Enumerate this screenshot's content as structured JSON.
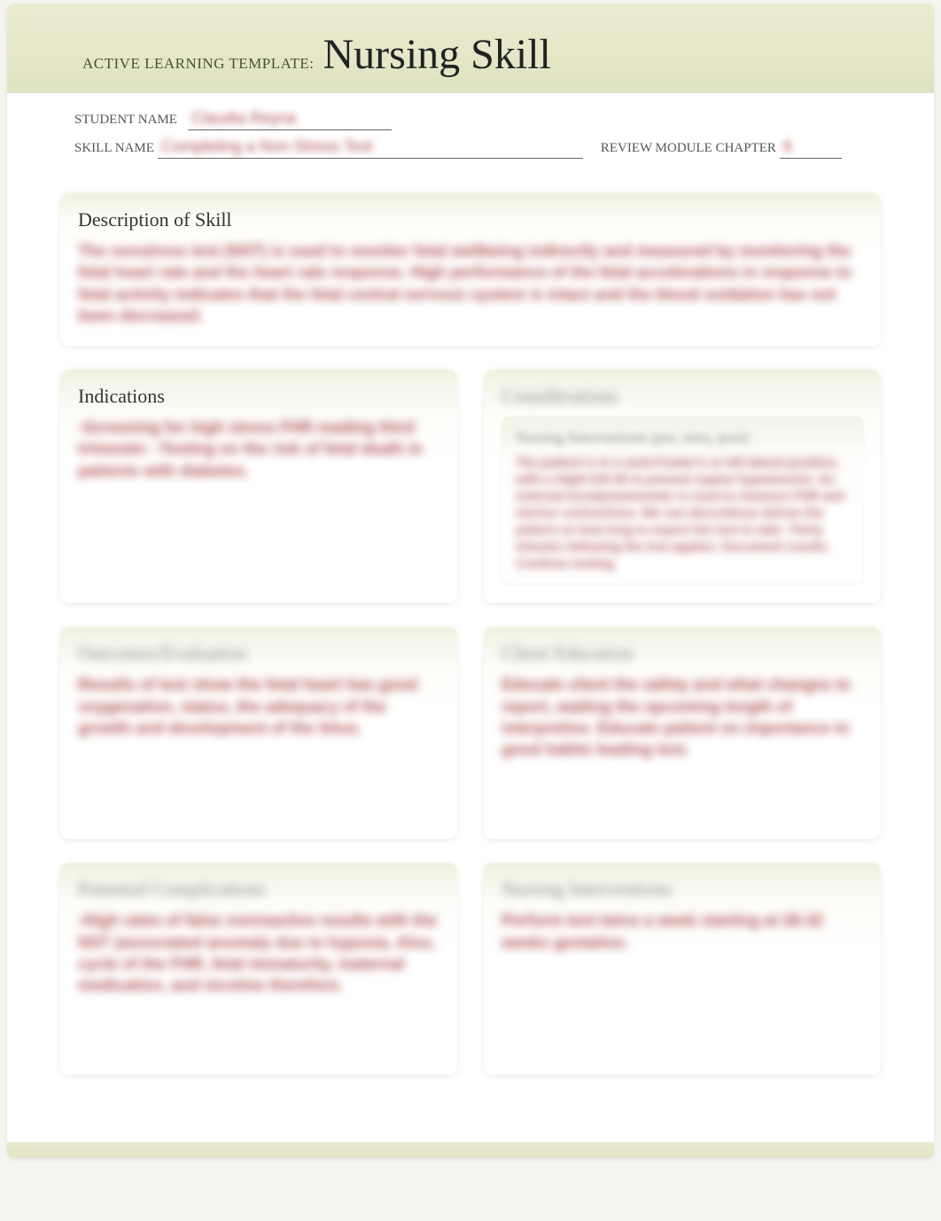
{
  "header": {
    "template_label": "ACTIVE LEARNING TEMPLATE:",
    "title": "Nursing Skill"
  },
  "fields": {
    "student_name_label": "STUDENT NAME",
    "student_name_value": "Claudia Reyna",
    "skill_name_label": "SKILL NAME",
    "skill_name_value": "Completing a Non-Stress Test",
    "review_label": "REVIEW MODULE CHAPTER",
    "review_value": "6"
  },
  "cards": {
    "description": {
      "title": "Description of Skill",
      "body": "The nonstress test (NST) is used to monitor fetal wellbeing indirectly and measured by monitoring the fetal heart rate and the heart rate response. High performance of the fetal accelerations in response to fetal activity indicates that the fetal central nervous system is intact and the blood oxidation has not been decreased."
    },
    "indications": {
      "title": "Indications",
      "body": "-Screening for high stress FHR reading third trimester.\n-Testing on the risk of fetal death in patients with diabetes."
    },
    "considerations": {
      "title": "Considerations",
      "nested_title": "Nursing Interventions (pre, intra, post)",
      "body": "The patient is in a semi-Fowler's or left lateral position, with a slight left tilt to prevent supine hypotension. An external tocodynamometer is used to measure FHR and uterine contractions. We can discontinue Advise the patient on how long to expect the test to take. Thirty minutes following the test applies. Document results. Continue testing."
    },
    "outcomes": {
      "title": "Outcomes/Evaluation",
      "body": "Results of test show the fetal heart has good oxygenation, status, the adequacy of the growth and development of the fetus."
    },
    "client_education": {
      "title": "Client Education",
      "body": "Educate client the safety and what changes to report, waiting the upcoming length of interpretive.\nEducate patient on importance to good habits leading test."
    },
    "potential_complications": {
      "title": "Potential Complications",
      "body": "-High rates of false nonreactive results with the NST (associated anomaly due to hypoxia.\nAlso, cycle of the FHR, fetal immaturity, maternal medication, and nicotine therefore."
    },
    "nursing_interventions": {
      "title": "Nursing Interventions",
      "body": "Perform test twice a week starting at 28-32 weeks gestation."
    }
  }
}
